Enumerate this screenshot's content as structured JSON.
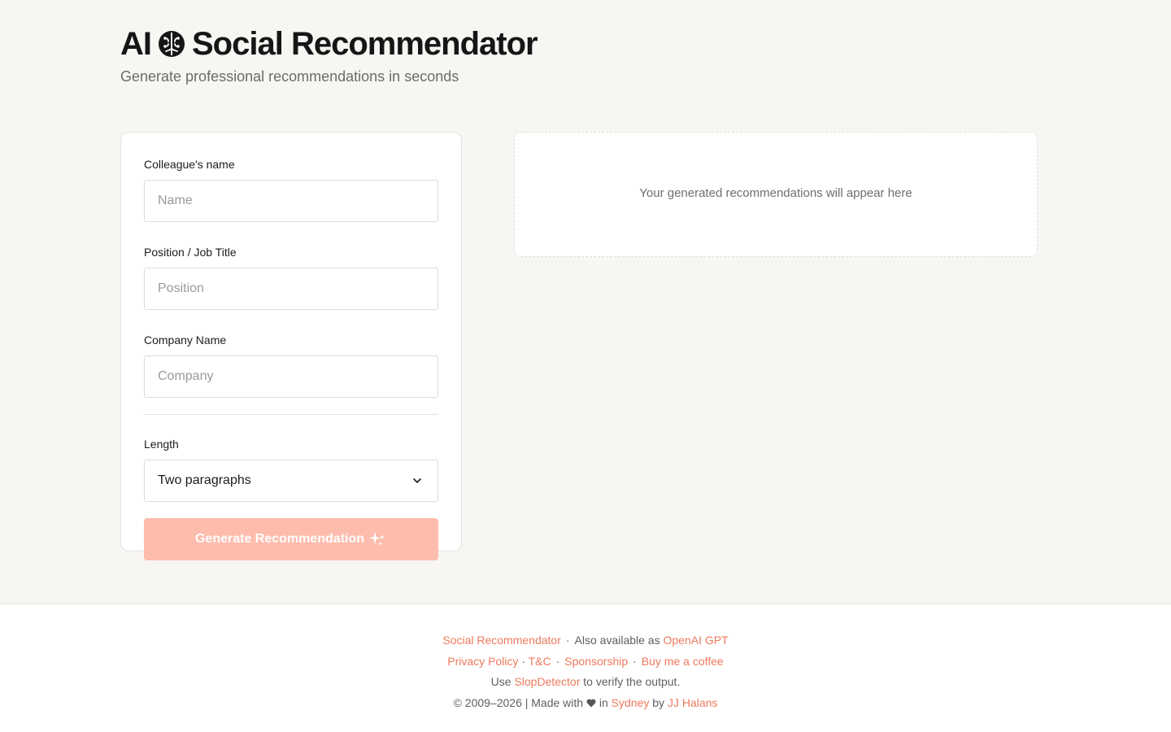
{
  "header": {
    "title_left": "AI",
    "title_right": "Social Recommendator",
    "brain_icon": "brain-icon",
    "subtitle": "Generate professional recommendations in seconds"
  },
  "form": {
    "name_label": "Colleague's name",
    "name_placeholder": "Name",
    "name_value": "",
    "position_label": "Position / Job Title",
    "position_placeholder": "Position",
    "position_value": "",
    "company_label": "Company Name",
    "company_placeholder": "Company",
    "company_value": "",
    "length_label": "Length",
    "length_selected": "Two paragraphs",
    "generate_label": "Generate Recommendation",
    "generate_icon": "sparkles-icon"
  },
  "output": {
    "placeholder": "Your generated recommendations will appear here"
  },
  "footer": {
    "line1_link1": "Social Recommendator",
    "line1_sep": "·",
    "line1_text": "Also available as",
    "line1_link2": "OpenAI GPT",
    "privacy": "Privacy Policy",
    "dot": "·",
    "tnc": "T&C",
    "sponsorship": "Sponsorship",
    "coffee": "Buy me a coffee",
    "use_text": "Use",
    "slop": "SlopDetector",
    "verify_text": "to verify the output.",
    "copyright": "© 2009–2026 | Made with",
    "in_text": "in",
    "sydney": "Sydney",
    "by_text": "by",
    "author": "JJ Halans"
  },
  "colors": {
    "accent": "#ee7a5e",
    "button_disabled": "#fdbcac",
    "background": "#f7f6f3"
  }
}
